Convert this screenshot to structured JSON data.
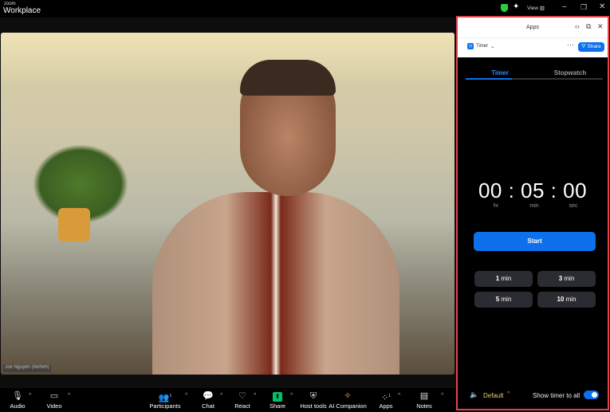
{
  "app": {
    "logo_top": "zoom",
    "logo_bottom": "Workplace",
    "view_label": "View"
  },
  "window_controls": [
    "minimize",
    "restore",
    "close"
  ],
  "video": {
    "participant_name": "Joe Nguyen (he/him)"
  },
  "toolbar": {
    "items": [
      {
        "label": "Audio",
        "icon": "microphone-icon",
        "glyph": "🎙"
      },
      {
        "label": "Video",
        "icon": "video-camera-icon",
        "glyph": "▭"
      },
      {
        "label": "Participants",
        "icon": "participants-icon",
        "glyph": "👥",
        "count": "1"
      },
      {
        "label": "Chat",
        "icon": "chat-icon",
        "glyph": "💬"
      },
      {
        "label": "React",
        "icon": "heart-icon",
        "glyph": "♡"
      },
      {
        "label": "Share",
        "icon": "share-arrow-icon",
        "glyph": "⬆"
      },
      {
        "label": "Host tools",
        "icon": "shield-icon",
        "glyph": "⛨"
      },
      {
        "label": "AI Companion",
        "icon": "sparkle-icon",
        "glyph": "✧"
      },
      {
        "label": "Apps",
        "icon": "apps-icon",
        "glyph": "⁘",
        "count": "1"
      },
      {
        "label": "Notes",
        "icon": "notes-icon",
        "glyph": "▤"
      }
    ]
  },
  "panel": {
    "title": "Apps",
    "app_name": "Timer",
    "share_label": "Share",
    "tabs": [
      {
        "label": "Timer",
        "active": true
      },
      {
        "label": "Stopwatch",
        "active": false
      }
    ],
    "time": {
      "hr": "00",
      "min": "05",
      "sec": "00",
      "display": "00 : 05 : 00"
    },
    "units": {
      "hr": "hr",
      "min": "min",
      "sec": "sec"
    },
    "start_label": "Start",
    "presets": [
      {
        "num": "1",
        "unit": "min"
      },
      {
        "num": "3",
        "unit": "min"
      },
      {
        "num": "5",
        "unit": "min"
      },
      {
        "num": "10",
        "unit": "min"
      }
    ],
    "sound": "Default",
    "show_timer_label": "Show timer to all",
    "show_timer_enabled": true
  },
  "colors": {
    "accent": "#0e71eb",
    "highlight_border": "#e8434b",
    "share_green": "#00c16b"
  }
}
